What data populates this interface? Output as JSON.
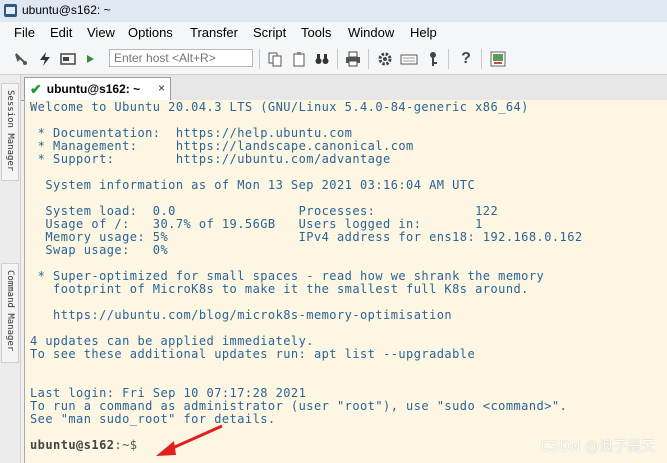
{
  "window": {
    "title": "ubuntu@s162: ~"
  },
  "menu": [
    "File",
    "Edit",
    "View",
    "Options",
    "Transfer",
    "Script",
    "Tools",
    "Window",
    "Help"
  ],
  "toolbar": {
    "host_placeholder": "Enter host <Alt+R>",
    "icons": [
      "connect-icon",
      "quick-connect-icon",
      "copy-icon",
      "paste-icon",
      "find-icon",
      "print-icon",
      "settings-icon",
      "keymap-icon",
      "key-icon",
      "help-icon",
      "sftp-icon"
    ]
  },
  "side_tabs": [
    "Session Manager",
    "Command Manager"
  ],
  "session_tab": {
    "label": "ubuntu@s162: ~",
    "close": "×"
  },
  "terminal": {
    "lines": [
      "Welcome to Ubuntu 20.04.3 LTS (GNU/Linux 5.4.0-84-generic x86_64)",
      "",
      " * Documentation:  https://help.ubuntu.com",
      " * Management:     https://landscape.canonical.com",
      " * Support:        https://ubuntu.com/advantage",
      "",
      "  System information as of Mon 13 Sep 2021 03:16:04 AM UTC",
      "",
      "  System load:  0.0                Processes:             122",
      "  Usage of /:   30.7% of 19.56GB   Users logged in:       1",
      "  Memory usage: 5%                 IPv4 address for ens18: 192.168.0.162",
      "  Swap usage:   0%",
      "",
      " * Super-optimized for small spaces - read how we shrank the memory",
      "   footprint of MicroK8s to make it the smallest full K8s around.",
      "",
      "   https://ubuntu.com/blog/microk8s-memory-optimisation",
      "",
      "4 updates can be applied immediately.",
      "To see these additional updates run: apt list --upgradable",
      "",
      "",
      "Last login: Fri Sep 10 07:17:28 2021",
      "To run a command as administrator (user \"root\"), use \"sudo <command>\".",
      "See \"man sudo_root\" for details.",
      ""
    ],
    "prompt_user": "ubuntu@s162",
    "prompt_rest": ":~$"
  },
  "watermark": "CSDN @浪子吴天",
  "colors": {
    "terminal_bg": "#fdf6e3",
    "terminal_fg": "#2a6496",
    "arrow": "#e02020"
  }
}
